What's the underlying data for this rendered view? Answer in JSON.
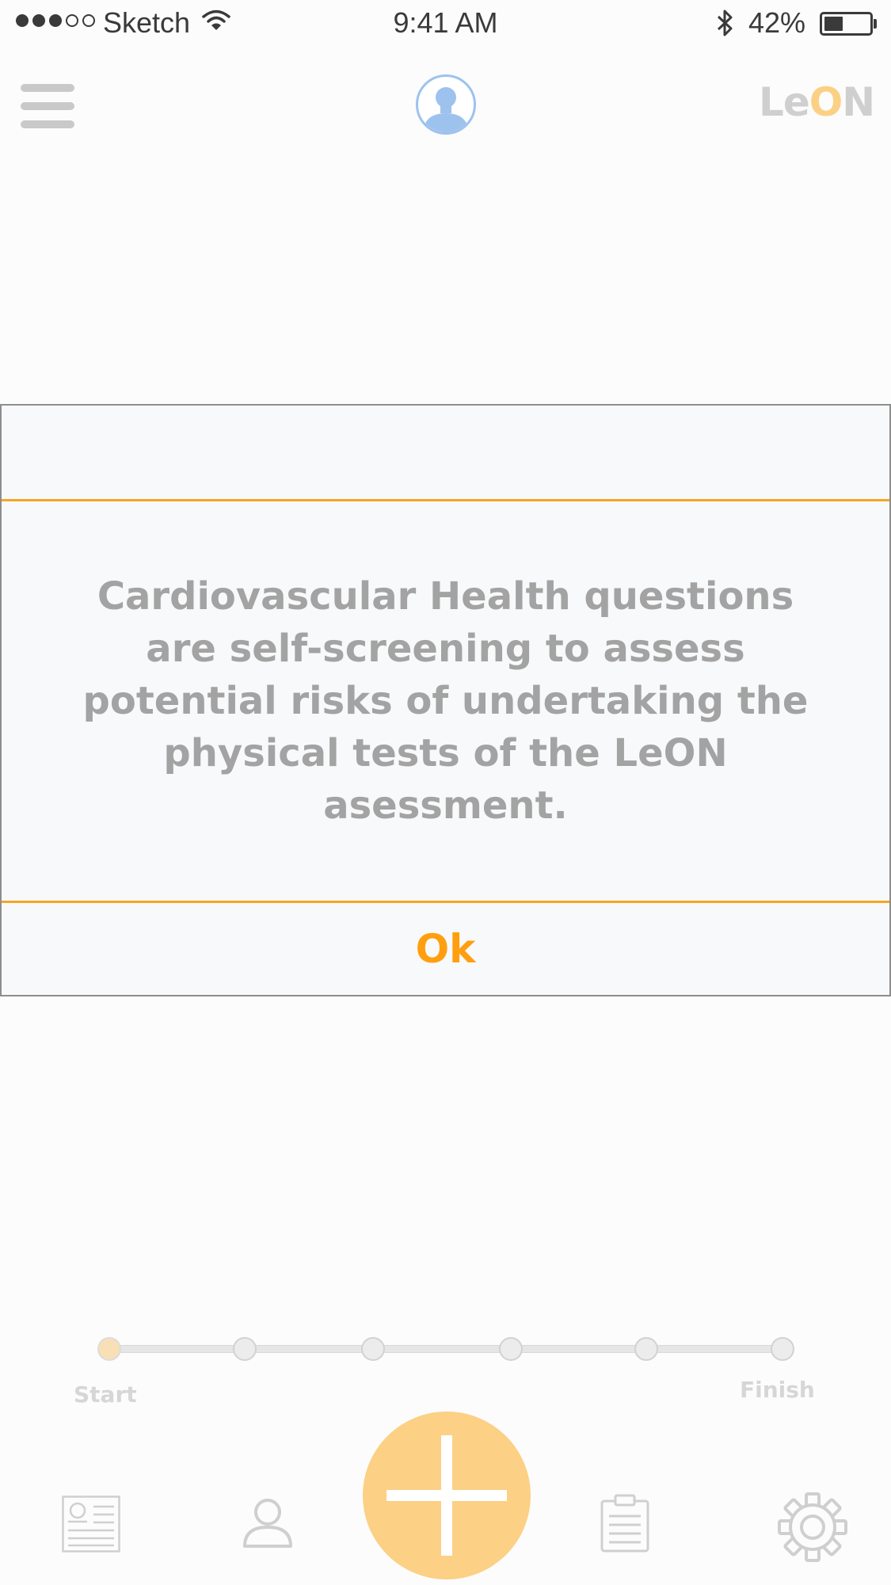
{
  "status_bar": {
    "carrier": "Sketch",
    "time": "9:41 AM",
    "battery_percent": "42%",
    "battery_level": 0.42
  },
  "nav": {
    "menu_icon": "hamburger-menu-icon",
    "avatar_icon": "user-avatar-icon",
    "logo": {
      "part1": "Le",
      "part2": "O",
      "part3": "N"
    }
  },
  "dialog": {
    "message": "Cardiovascular Health questions are self-screening to assess potential risks of undertaking the physical tests of the LeON asessment.",
    "ok_label": "Ok"
  },
  "progress": {
    "start_label": "Start",
    "finish_label": "Finish",
    "steps": 6,
    "current_step": 1
  },
  "tab_bar": {
    "icons": [
      "news-icon",
      "profile-icon",
      "add-icon",
      "clipboard-icon",
      "settings-gear-icon"
    ]
  },
  "colors": {
    "accent": "#f5a623",
    "ok_text": "#ff9f0f",
    "fab": "#fcd085",
    "logo_o": "#fcd084",
    "avatar": "#9ec2ee"
  }
}
